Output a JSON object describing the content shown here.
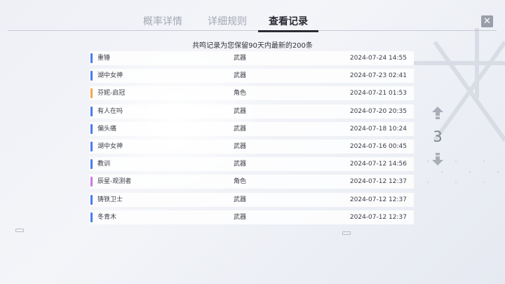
{
  "tabs": [
    {
      "label": "概率详情",
      "active": false
    },
    {
      "label": "详细规则",
      "active": false
    },
    {
      "label": "查看记录",
      "active": true
    }
  ],
  "close_label": "✕",
  "notice": "共鸣记录为您保留90天内最新的200条",
  "records": [
    {
      "name": "重锤",
      "type": "武器",
      "time": "2024-07-24 14:55",
      "rarity_color": "#4a7bf0"
    },
    {
      "name": "湖中女神",
      "type": "武器",
      "time": "2024-07-23 02:41",
      "rarity_color": "#4a7bf0"
    },
    {
      "name": "芬妮-启冠",
      "type": "角色",
      "time": "2024-07-21 01:53",
      "rarity_color": "#f0a84a"
    },
    {
      "name": "有人在吗",
      "type": "武器",
      "time": "2024-07-20 20:35",
      "rarity_color": "#4a7bf0"
    },
    {
      "name": "偏头痛",
      "type": "武器",
      "time": "2024-07-18 10:24",
      "rarity_color": "#4a7bf0"
    },
    {
      "name": "湖中女神",
      "type": "武器",
      "time": "2024-07-16 00:45",
      "rarity_color": "#4a7bf0"
    },
    {
      "name": "教训",
      "type": "武器",
      "time": "2024-07-12 14:56",
      "rarity_color": "#4a7bf0"
    },
    {
      "name": "辰星-观测者",
      "type": "角色",
      "time": "2024-07-12 12:37",
      "rarity_color": "#c87ae0"
    },
    {
      "name": "铸铁卫士",
      "type": "武器",
      "time": "2024-07-12 12:37",
      "rarity_color": "#4a7bf0"
    },
    {
      "name": "冬青木",
      "type": "武器",
      "time": "2024-07-12 12:37",
      "rarity_color": "#4a7bf0"
    }
  ],
  "pagination": {
    "current_page": "3"
  },
  "icons": {
    "up": "arrow-up-icon",
    "down": "arrow-down-icon",
    "close": "close-icon"
  }
}
